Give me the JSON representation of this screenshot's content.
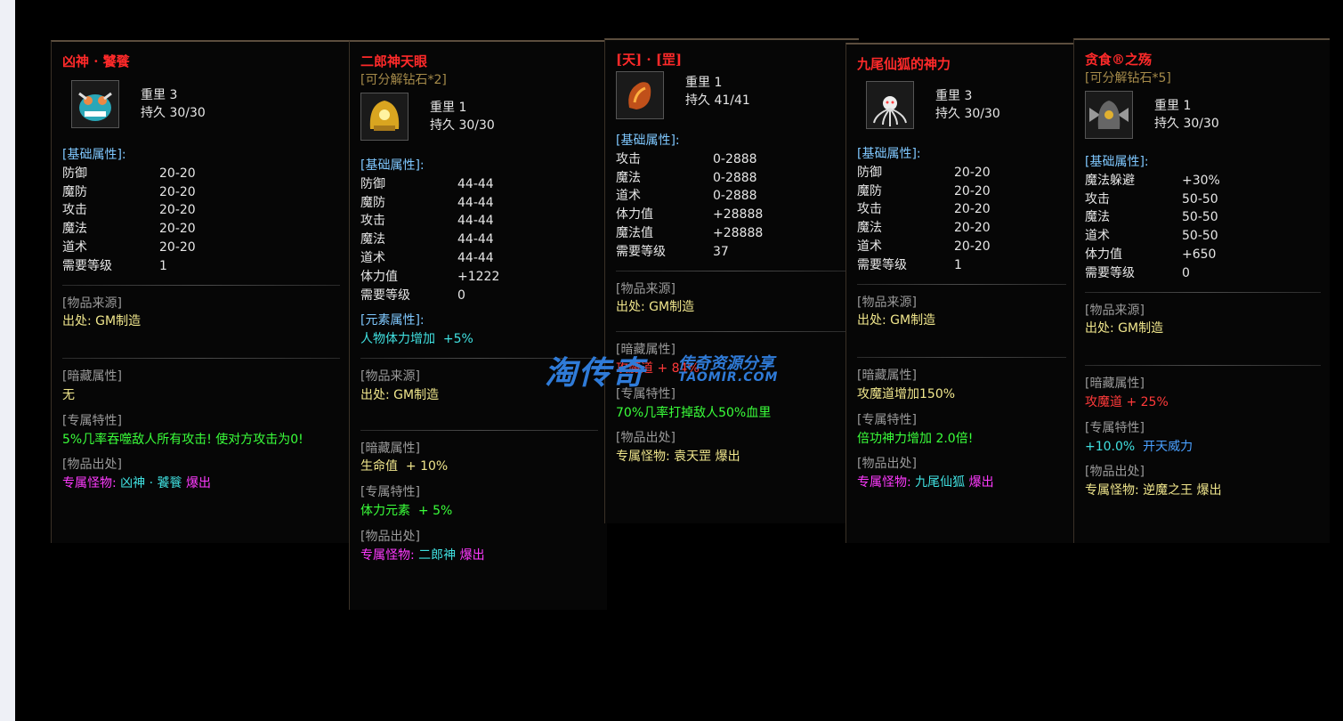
{
  "cards": [
    {
      "title": "凶神 · 饕餮",
      "subtitle": "",
      "weight_label": "重里",
      "weight": "3",
      "dur_label": "持久",
      "dur": "30/30",
      "base_label": "[基础属性]:",
      "stats": [
        [
          "防御",
          "20-20"
        ],
        [
          "魔防",
          "20-20"
        ],
        [
          "攻击",
          "20-20"
        ],
        [
          "魔法",
          "20-20"
        ],
        [
          "道术",
          "20-20"
        ],
        [
          "需要等级",
          "1"
        ]
      ],
      "src_label": "[物品来源]",
      "src": "出处: GM制造",
      "hidden_label": "[暗藏属性]",
      "hidden": "无",
      "special_label": "[专属特性]",
      "special": "5%几率吞噬敌人所有攻击! 使对方攻击为0!",
      "drop_label": "[物品出处]",
      "drop_prefix": "专属怪物:",
      "drop_monster": "凶神 · 饕餮",
      "drop_suffix": "爆出"
    },
    {
      "title": "二郎神天眼",
      "subtitle": "[可分解钻石*2]",
      "weight_label": "重里",
      "weight": "1",
      "dur_label": "持久",
      "dur": "30/30",
      "base_label": "[基础属性]:",
      "stats": [
        [
          "防御",
          "44-44"
        ],
        [
          "魔防",
          "44-44"
        ],
        [
          "攻击",
          "44-44"
        ],
        [
          "魔法",
          "44-44"
        ],
        [
          "道术",
          "44-44"
        ],
        [
          "体力值",
          "+1222"
        ],
        [
          "需要等级",
          "0"
        ]
      ],
      "elem_label": "[元素属性]:",
      "elem_name": "人物体力增加",
      "elem_val": "+5%",
      "src_label": "[物品来源]",
      "src": "出处: GM制造",
      "hidden_label": "[暗藏属性]",
      "hidden_name": "生命值",
      "hidden_val": "+ 10%",
      "special_label": "[专属特性]",
      "special_name": "体力元素",
      "special_val": "+ 5%",
      "drop_label": "[物品出处]",
      "drop_prefix": "专属怪物:",
      "drop_monster": "二郎神",
      "drop_suffix": "爆出"
    },
    {
      "title": "[天] · [罡]",
      "subtitle": "",
      "weight_label": "重里",
      "weight": "1",
      "dur_label": "持久",
      "dur": "41/41",
      "base_label": "[基础属性]:",
      "stats": [
        [
          "攻击",
          "0-2888"
        ],
        [
          "魔法",
          "0-2888"
        ],
        [
          "道术",
          "0-2888"
        ],
        [
          "体力值",
          "+28888"
        ],
        [
          "魔法值",
          "+28888"
        ],
        [
          "需要等级",
          "37"
        ]
      ],
      "src_label": "[物品来源]",
      "src": "出处: GM制造",
      "hidden_label": "[暗藏属性]",
      "hidden_name": "攻魔道",
      "hidden_val": "+ 84%",
      "special_label": "[专属特性]",
      "special": "70%几率打掉敌人50%血里",
      "drop_label": "[物品出处]",
      "drop_prefix": "专属怪物:",
      "drop_monster": "袁天罡",
      "drop_suffix": "爆出"
    },
    {
      "title": "九尾仙狐的神力",
      "subtitle": "",
      "weight_label": "重里",
      "weight": "3",
      "dur_label": "持久",
      "dur": "30/30",
      "base_label": "[基础属性]:",
      "stats": [
        [
          "防御",
          "20-20"
        ],
        [
          "魔防",
          "20-20"
        ],
        [
          "攻击",
          "20-20"
        ],
        [
          "魔法",
          "20-20"
        ],
        [
          "道术",
          "20-20"
        ],
        [
          "需要等级",
          "1"
        ]
      ],
      "src_label": "[物品来源]",
      "src": "出处: GM制造",
      "hidden_label": "[暗藏属性]",
      "hidden": "攻魔道增加150%",
      "special_label": "[专属特性]",
      "special": "倍功神力增加 2.0倍!",
      "drop_label": "[物品出处]",
      "drop_prefix": "专属怪物:",
      "drop_monster": "九尾仙狐",
      "drop_suffix": "爆出"
    },
    {
      "title": "贪食®之殇",
      "subtitle": "[可分解钻石*5]",
      "weight_label": "重里",
      "weight": "1",
      "dur_label": "持久",
      "dur": "30/30",
      "base_label": "[基础属性]:",
      "stats": [
        [
          "魔法躲避",
          "+30%"
        ],
        [
          "攻击",
          "50-50"
        ],
        [
          "魔法",
          "50-50"
        ],
        [
          "道术",
          "50-50"
        ],
        [
          "体力值",
          "+650"
        ],
        [
          "需要等级",
          "0"
        ]
      ],
      "src_label": "[物品来源]",
      "src": "出处: GM制造",
      "hidden_label": "[暗藏属性]",
      "hidden_name": "攻魔道",
      "hidden_val": "+ 25%",
      "special_label": "[专属特性]",
      "special_name": "+10.0%",
      "special_val": "开天威力",
      "drop_label": "[物品出处]",
      "drop_prefix": "专属怪物:",
      "drop_monster": "逆魔之王",
      "drop_suffix": "爆出"
    }
  ],
  "watermark": {
    "main": "淘传奇",
    "sub": "传奇资源分享",
    "url": "TAOMIR.COM"
  }
}
